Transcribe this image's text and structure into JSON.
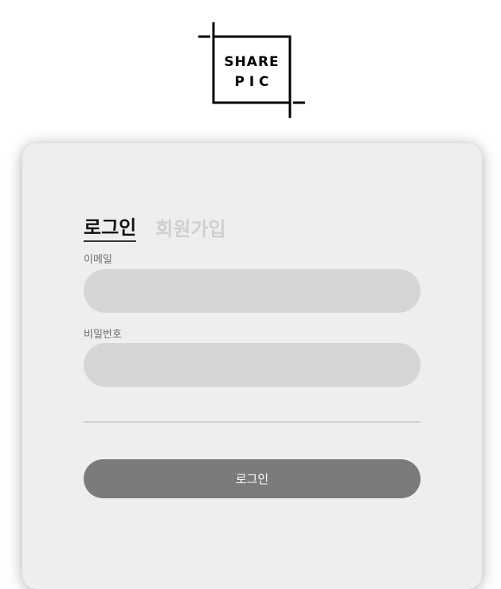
{
  "logo": {
    "line1": "SHARE",
    "line2": "P I C",
    "icon": "share-pic-logo"
  },
  "tabs": [
    {
      "label": "로그인",
      "active": true
    },
    {
      "label": "회원가입",
      "active": false
    }
  ],
  "form": {
    "email": {
      "label": "이메일",
      "value": "",
      "placeholder": ""
    },
    "password": {
      "label": "비밀번호",
      "value": "",
      "placeholder": ""
    }
  },
  "submit_label": "로그인",
  "colors": {
    "card_bg": "#eeeeee",
    "input_bg": "#d6d6d6",
    "button_bg": "#7b7b7b",
    "tab_active": "#111111",
    "tab_inactive": "#cfcfcf"
  }
}
